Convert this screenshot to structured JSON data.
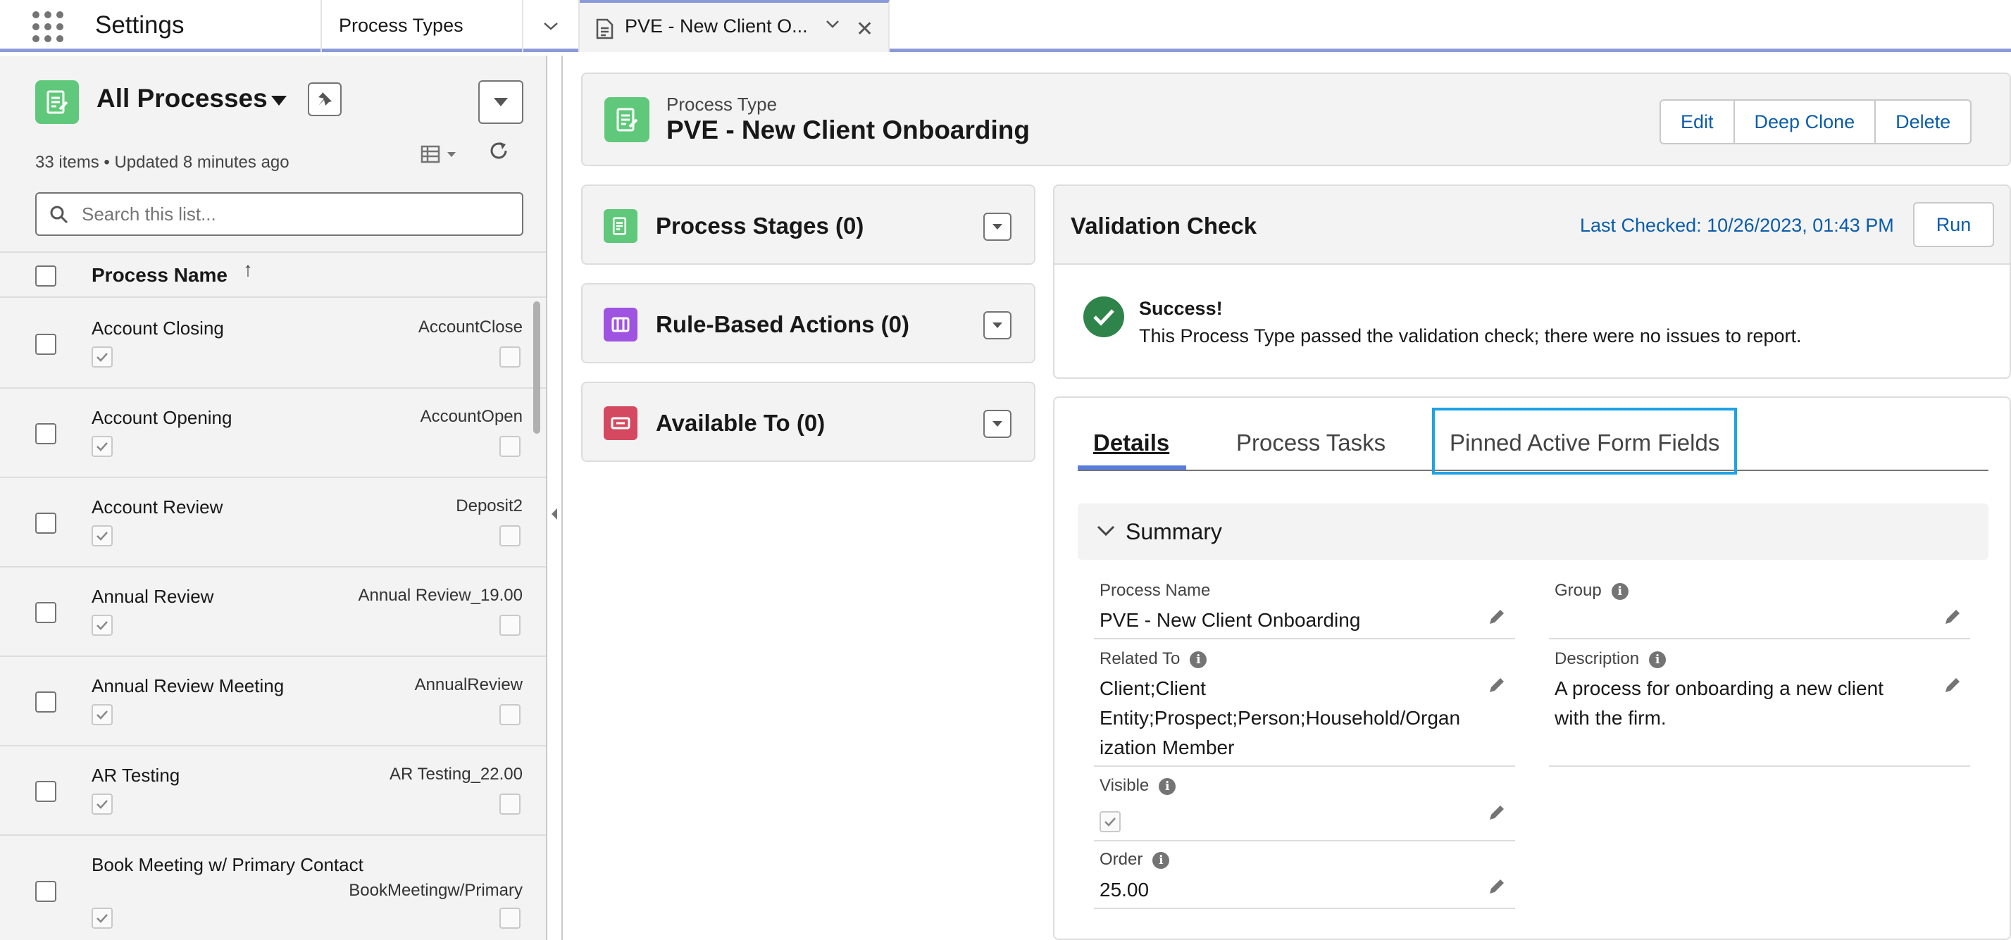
{
  "app": {
    "name": "Settings"
  },
  "tabs": {
    "process_types": "Process Types",
    "active_record": "PVE - New Client O..."
  },
  "list": {
    "title": "All Processes",
    "meta": "33 items • Updated 8 minutes ago",
    "search_placeholder": "Search this list...",
    "column_header": "Process Name",
    "sort_indicator": "↑",
    "rows": [
      {
        "name": "Account Closing",
        "api": "AccountClose"
      },
      {
        "name": "Account Opening",
        "api": "AccountOpen"
      },
      {
        "name": "Account Review",
        "api": "Deposit2"
      },
      {
        "name": "Annual Review",
        "api": "Annual Review_19.00"
      },
      {
        "name": "Annual Review Meeting",
        "api": "AnnualReview"
      },
      {
        "name": "AR Testing",
        "api": "AR Testing_22.00"
      },
      {
        "name": "Book Meeting w/ Primary Contact",
        "api": "BookMeetingw/Primary"
      }
    ]
  },
  "record": {
    "type_label": "Process Type",
    "name": "PVE - New Client Onboarding",
    "buttons": {
      "edit": "Edit",
      "deep_clone": "Deep Clone",
      "delete": "Delete"
    }
  },
  "related": {
    "stages": "Process Stages (0)",
    "actions": "Rule-Based Actions (0)",
    "available": "Available To (0)"
  },
  "validation": {
    "title": "Validation Check",
    "last_checked": "Last Checked: 10/26/2023, 01:43 PM",
    "run_label": "Run",
    "status_title": "Success!",
    "status_message": "This Process Type passed the validation check; there were no issues to report."
  },
  "detail_tabs": {
    "details": "Details",
    "process_tasks": "Process Tasks",
    "pinned": "Pinned Active Form Fields"
  },
  "summary": {
    "label": "Summary",
    "fields": {
      "process_name": {
        "label": "Process Name",
        "value": "PVE - New Client Onboarding"
      },
      "group": {
        "label": "Group",
        "value": ""
      },
      "related_to": {
        "label": "Related To",
        "value_line1": "Client;Client",
        "value_line2": "Entity;Prospect;Person;Household/Organ",
        "value_line3": "ization Member"
      },
      "description": {
        "label": "Description",
        "value_line1": "A process for onboarding a new client",
        "value_line2": "with the firm."
      },
      "visible": {
        "label": "Visible",
        "value": true
      },
      "order": {
        "label": "Order",
        "value": "25.00"
      }
    }
  },
  "colors": {
    "accent": "#0b5cab",
    "process_icon": "#5fc87a",
    "rule_icon": "#9e54e0",
    "available_icon": "#d4495f",
    "success": "#2e844a",
    "focus_outline": "#1fa2e6"
  }
}
